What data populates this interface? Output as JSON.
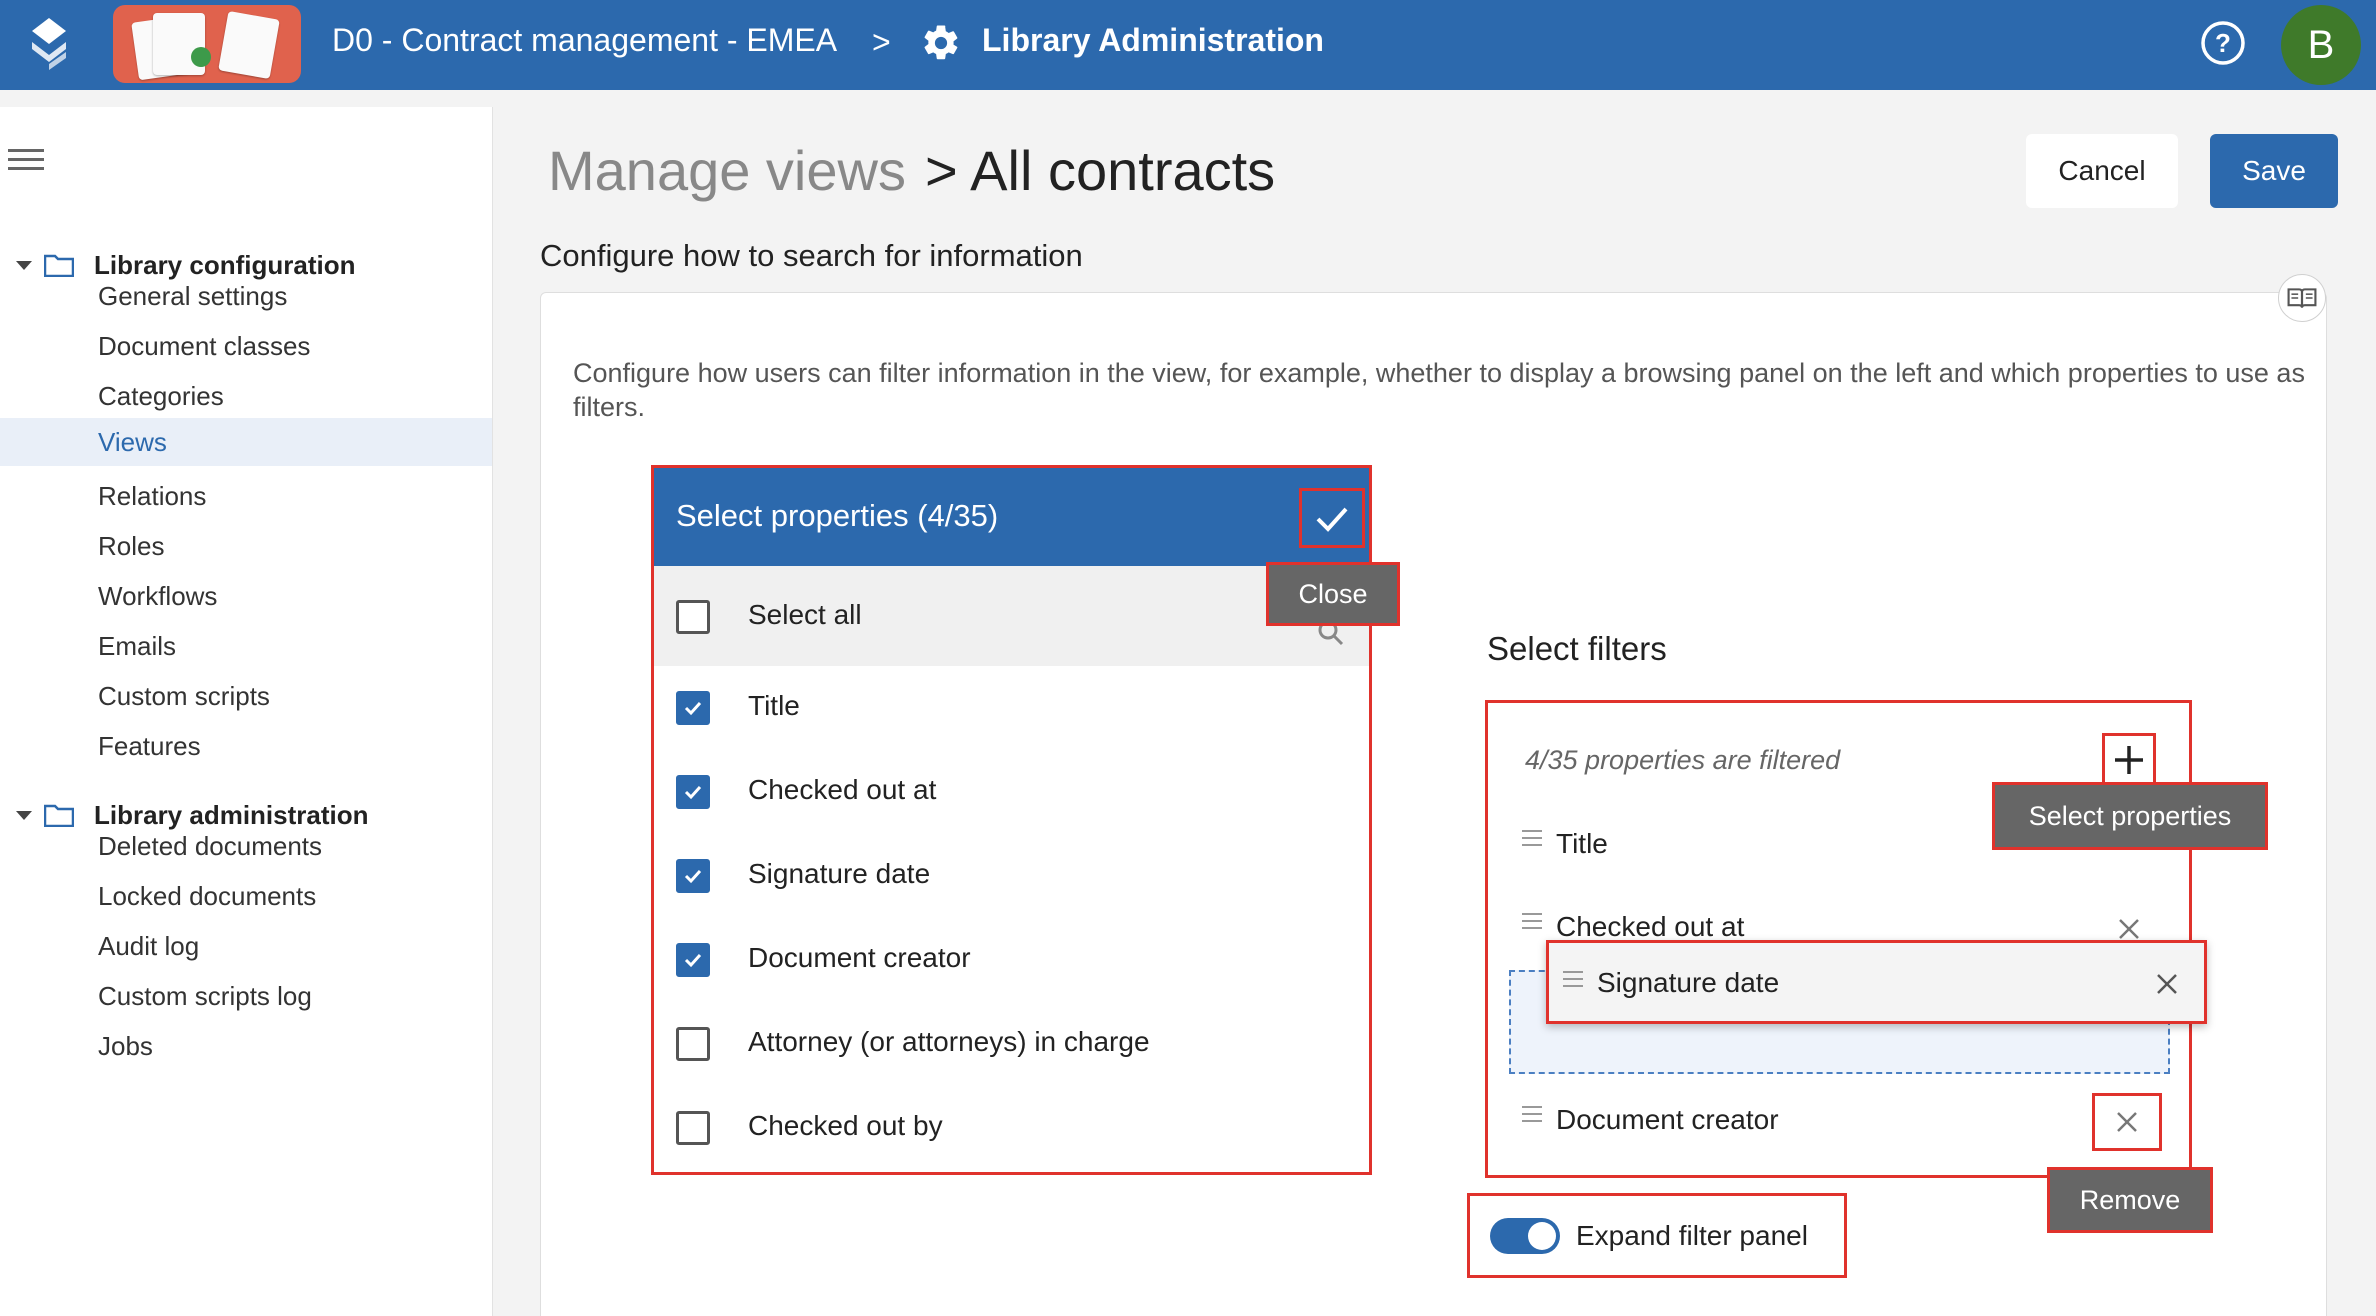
{
  "header": {
    "app_name": "D0 - Contract management - EMEA",
    "separator": ">",
    "page_name": "Library Administration",
    "avatar_initial": "B"
  },
  "sidebar": {
    "sections": [
      {
        "label": "Library configuration",
        "items": [
          "General settings",
          "Document classes",
          "Categories",
          "Views",
          "Relations",
          "Roles",
          "Workflows",
          "Emails",
          "Custom scripts",
          "Features"
        ]
      },
      {
        "label": "Library administration",
        "items": [
          "Deleted documents",
          "Locked documents",
          "Audit log",
          "Custom scripts log",
          "Jobs"
        ]
      }
    ],
    "active_item": "Views"
  },
  "main": {
    "breadcrumb_parent": "Manage views",
    "breadcrumb_current": "> All contracts",
    "cancel_label": "Cancel",
    "save_label": "Save",
    "section_title": "Configure how to search for information",
    "description": "Configure how users can filter information in the view, for example, whether to display a browsing panel on the left and which properties to use as filters."
  },
  "properties_panel": {
    "title": "Select properties (4/35)",
    "select_all_label": "Select all",
    "close_tooltip": "Close",
    "items": [
      {
        "label": "Title",
        "checked": true
      },
      {
        "label": "Checked out at",
        "checked": true
      },
      {
        "label": "Signature date",
        "checked": true
      },
      {
        "label": "Document creator",
        "checked": true
      },
      {
        "label": "Attorney (or attorneys) in charge",
        "checked": false
      },
      {
        "label": "Checked out by",
        "checked": false
      }
    ]
  },
  "filters": {
    "title": "Select filters",
    "count_text": "4/35 properties are filtered",
    "select_properties_tooltip": "Select properties",
    "items": [
      "Title",
      "Checked out at",
      "Signature date",
      "Document creator"
    ],
    "remove_tooltip": "Remove",
    "expand_label": "Expand filter panel",
    "expand_enabled": true
  },
  "colors": {
    "brand": "#2c69ad",
    "highlight": "#e0322c",
    "avatar": "#3f7a2a"
  }
}
